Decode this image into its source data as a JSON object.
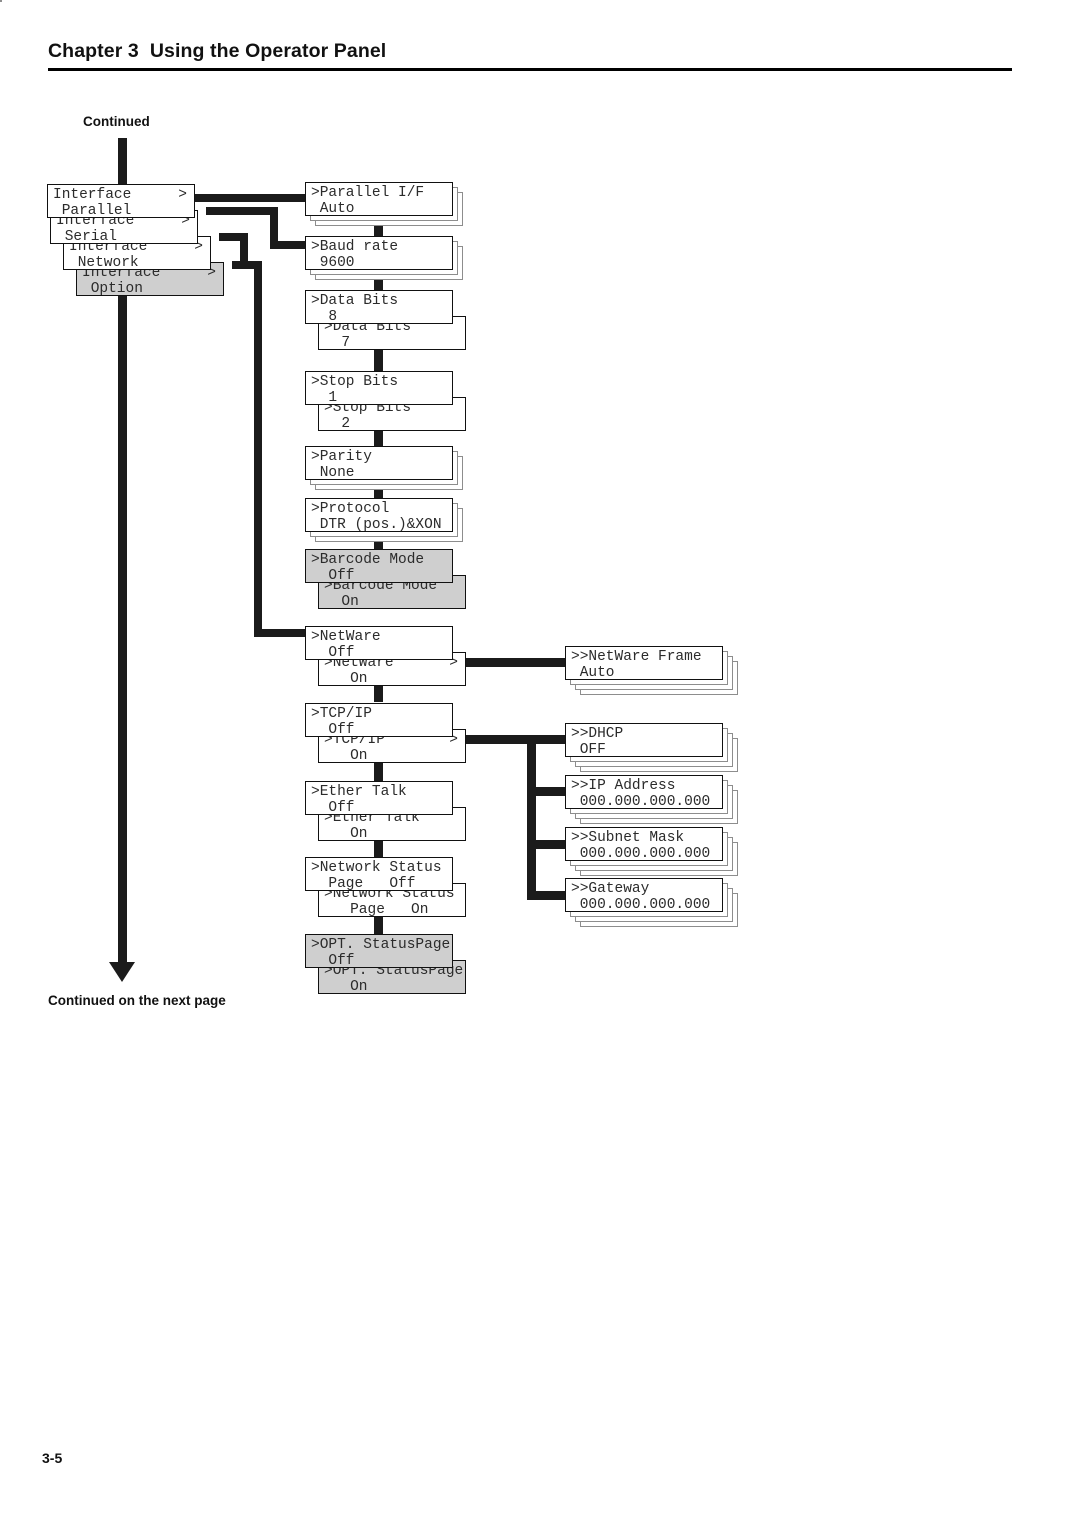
{
  "header": {
    "chapter": "Chapter 3",
    "title": "Using the Operator Panel",
    "full": "Chapter 3  Using the Operator Panel"
  },
  "labels": {
    "continued": "Continued",
    "continued_next": "Continued on the next page",
    "page_number": "3-5"
  },
  "colors": {
    "line": "#1b1b1b",
    "box_border": "#111111",
    "shadow_border": "#8d8d8d",
    "gray_fill": "#cfcfcf",
    "text": "#2b2b2b"
  },
  "menu": {
    "interface_options": [
      {
        "line1": "Interface",
        "line2": " Parallel",
        "arrow": ">",
        "gray": false
      },
      {
        "line1": "Interface",
        "line2": " Serial",
        "arrow": ">",
        "gray": false
      },
      {
        "line1": "Interface",
        "line2": " Network",
        "arrow": ">",
        "gray": false
      },
      {
        "line1": "Interface",
        "line2": " Option",
        "arrow": ">",
        "gray": true
      }
    ],
    "settings": [
      {
        "name": "parallel-if",
        "primary": {
          "line1": ">Parallel I/F",
          "line2": " Auto",
          "arrow": "",
          "gray": false
        },
        "stack": 2,
        "alt": null
      },
      {
        "name": "baud-rate",
        "primary": {
          "line1": ">Baud rate",
          "line2": " 9600",
          "arrow": "",
          "gray": false
        },
        "stack": 2,
        "alt": null
      },
      {
        "name": "data-bits",
        "primary": {
          "line1": ">Data Bits",
          "line2": "  8",
          "arrow": "",
          "gray": false
        },
        "stack": 0,
        "alt": {
          "line1": ">Data Bits",
          "line2": "  7",
          "arrow": "",
          "gray": false
        }
      },
      {
        "name": "stop-bits",
        "primary": {
          "line1": ">Stop Bits",
          "line2": "  1",
          "arrow": "",
          "gray": false
        },
        "stack": 0,
        "alt": {
          "line1": ">Stop Bits",
          "line2": "  2",
          "arrow": "",
          "gray": false
        }
      },
      {
        "name": "parity",
        "primary": {
          "line1": ">Parity",
          "line2": " None",
          "arrow": "",
          "gray": false
        },
        "stack": 2,
        "alt": null
      },
      {
        "name": "protocol",
        "primary": {
          "line1": ">Protocol",
          "line2": " DTR (pos.)&XON",
          "arrow": "",
          "gray": false
        },
        "stack": 2,
        "alt": null
      },
      {
        "name": "barcode-mode",
        "primary": {
          "line1": ">Barcode Mode",
          "line2": "  Off",
          "arrow": "",
          "gray": true
        },
        "stack": 0,
        "alt": {
          "line1": ">Barcode Mode",
          "line2": "  On",
          "arrow": "",
          "gray": true
        }
      },
      {
        "name": "netware",
        "primary": {
          "line1": ">NetWare",
          "line2": "  Off",
          "arrow": "",
          "gray": false
        },
        "stack": 0,
        "alt": {
          "line1": ">NetWare",
          "line2": "   On",
          "arrow": ">",
          "gray": false
        }
      },
      {
        "name": "tcp-ip",
        "primary": {
          "line1": ">TCP/IP",
          "line2": "  Off",
          "arrow": "",
          "gray": false
        },
        "stack": 0,
        "alt": {
          "line1": ">TCP/IP",
          "line2": "   On",
          "arrow": ">",
          "gray": false
        }
      },
      {
        "name": "ether-talk",
        "primary": {
          "line1": ">Ether Talk",
          "line2": "  Off",
          "arrow": "",
          "gray": false
        },
        "stack": 0,
        "alt": {
          "line1": ">Ether Talk",
          "line2": "   On",
          "arrow": "",
          "gray": false
        }
      },
      {
        "name": "network-status-page",
        "primary": {
          "line1": ">Network Status",
          "line2": "  Page   Off",
          "arrow": "",
          "gray": false
        },
        "stack": 0,
        "alt": {
          "line1": ">Network Status",
          "line2": "   Page   On",
          "arrow": "",
          "gray": false
        }
      },
      {
        "name": "opt-status-page",
        "primary": {
          "line1": ">OPT. StatusPage",
          "line2": "  Off",
          "arrow": "",
          "gray": true
        },
        "stack": 0,
        "alt": {
          "line1": ">OPT. StatusPage",
          "line2": "   On",
          "arrow": "",
          "gray": true
        }
      }
    ],
    "sub_settings": [
      {
        "name": "netware-frame",
        "line1": ">>NetWare Frame",
        "line2": " Auto",
        "stack": 3
      },
      {
        "name": "dhcp",
        "line1": ">>DHCP",
        "line2": " OFF",
        "stack": 3
      },
      {
        "name": "ip-address",
        "line1": ">>IP Address",
        "line2": " 000.000.000.000",
        "stack": 3
      },
      {
        "name": "subnet-mask",
        "line1": ">>Subnet Mask",
        "line2": " 000.000.000.000",
        "stack": 3
      },
      {
        "name": "gateway",
        "line1": ">>Gateway",
        "line2": " 000.000.000.000",
        "stack": 3
      }
    ]
  }
}
